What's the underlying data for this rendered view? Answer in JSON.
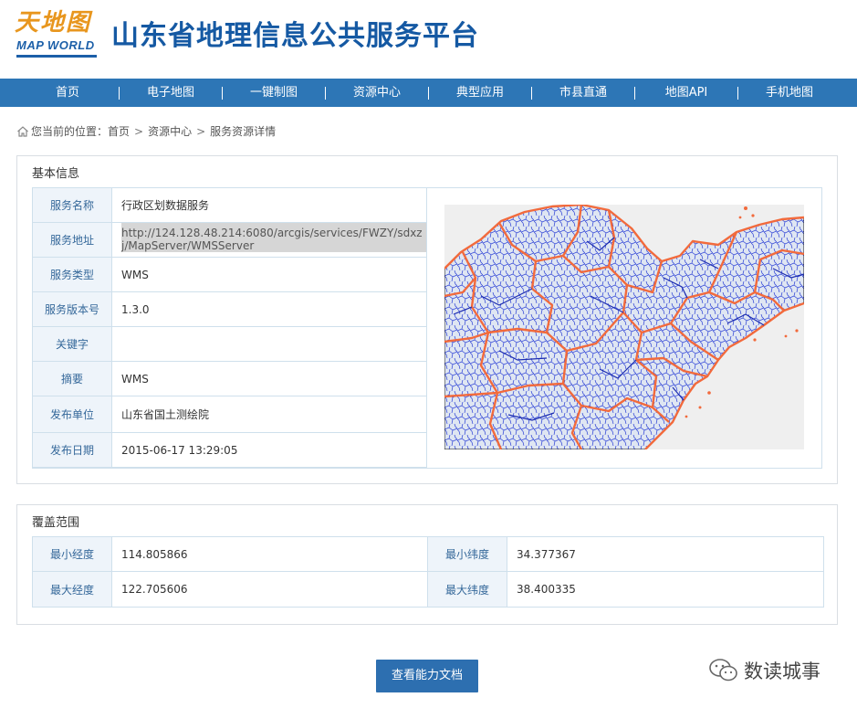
{
  "header": {
    "logo_text_top": "天地图",
    "logo_text_bottom": "MAP WORLD",
    "title": "山东省地理信息公共服务平台"
  },
  "nav": {
    "items": [
      "首页",
      "电子地图",
      "一键制图",
      "资源中心",
      "典型应用",
      "市县直通",
      "地图API",
      "手机地图"
    ]
  },
  "breadcrumb": {
    "prefix": "您当前的位置：",
    "items": [
      "首页",
      "资源中心",
      "服务资源详情"
    ],
    "separator": ">"
  },
  "basic_info": {
    "title": "基本信息",
    "rows": [
      {
        "label": "服务名称",
        "value": "行政区划数据服务"
      },
      {
        "label": "服务地址",
        "value": "http://124.128.48.214:6080/arcgis/services/FWZY/sdxzj/MapServer/WMSServer"
      },
      {
        "label": "服务类型",
        "value": "WMS"
      },
      {
        "label": "服务版本号",
        "value": "1.3.0"
      },
      {
        "label": "关键字",
        "value": ""
      },
      {
        "label": "摘要",
        "value": "WMS"
      },
      {
        "label": "发布单位",
        "value": "山东省国土测绘院"
      },
      {
        "label": "发布日期",
        "value": "2015-06-17 13:29:05"
      }
    ]
  },
  "coverage": {
    "title": "覆盖范围",
    "min_lon_label": "最小经度",
    "min_lon": "114.805866",
    "min_lat_label": "最小纬度",
    "min_lat": "34.377367",
    "max_lon_label": "最大经度",
    "max_lon": "122.705606",
    "max_lat_label": "最大纬度",
    "max_lat": "38.400335"
  },
  "doc_button": "查看能力文档",
  "watermark": "数读城事",
  "colors": {
    "nav_bg": "#2d76b6",
    "title_blue": "#1559a3",
    "label_bg": "#eef4fa",
    "label_text": "#35689a",
    "button_bg": "#2d6fb0",
    "map_boundary_orange": "#f26a3c",
    "map_boundary_blue": "#2a3fd6"
  }
}
